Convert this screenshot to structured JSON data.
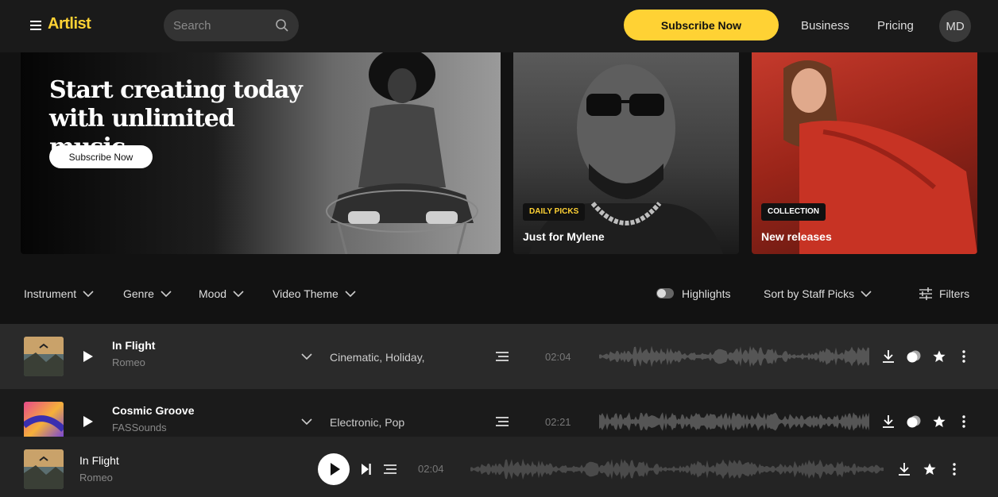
{
  "header": {
    "logo": "Artlist",
    "search_placeholder": "Search",
    "subscribe_label": "Subscribe Now",
    "nav": [
      "Business",
      "Pricing"
    ],
    "avatar_initials": "MD"
  },
  "hero": {
    "title": "Start creating today with unlimited music",
    "button_label": "Subscribe Now"
  },
  "cards": [
    {
      "badge": "DAILY PICKS",
      "badge_color": "#ffd234",
      "title": "Just for Mylene"
    },
    {
      "badge": "COLLECTION",
      "badge_color": "#ffffff",
      "title": "New releases"
    }
  ],
  "filters": {
    "dropdowns": [
      "Instrument",
      "Genre",
      "Mood",
      "Video Theme"
    ],
    "highlights_label": "Highlights",
    "sort_label": "Sort by Staff Picks",
    "filters_label": "Filters"
  },
  "tracks": [
    {
      "title": "In Flight",
      "artist": "Romeo",
      "genres": "Cinematic, Holiday,",
      "duration": "02:04"
    },
    {
      "title": "Cosmic Groove",
      "artist": "FASSounds",
      "genres": "Electronic, Pop",
      "duration": "02:21"
    }
  ],
  "player": {
    "title": "In Flight",
    "artist": "Romeo",
    "duration": "02:04"
  },
  "colors": {
    "accent": "#ffd234",
    "background": "#121212"
  }
}
